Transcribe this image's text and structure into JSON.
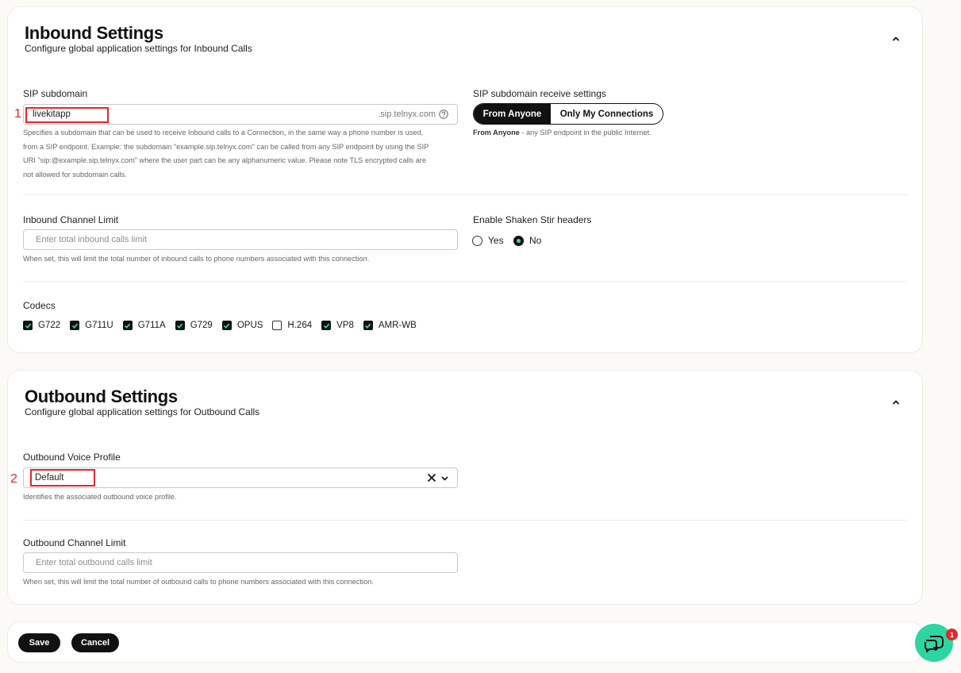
{
  "inbound": {
    "title": "Inbound Settings",
    "subtitle": "Configure global application settings for Inbound Calls",
    "sip_subdomain": {
      "label": "SIP subdomain",
      "value": "livekitapp",
      "suffix": ".sip.telnyx.com",
      "help": "Specifies a subdomain that can be used to receive Inbound calls to a Connection, in the same way a phone number is used, from a SIP endpoint. Example: the subdomain \"example.sip.telnyx.com\" can be called from any SIP endpoint by using the SIP URI \"sip:@example.sip.telnyx.com\" where the user part can be any alphanumeric value. Please note TLS encrypted calls are not allowed for subdomain calls.",
      "marker": "1"
    },
    "receive_settings": {
      "label": "SIP subdomain receive settings",
      "options": [
        "From Anyone",
        "Only My Connections"
      ],
      "selected": "From Anyone",
      "help_bold": "From Anyone",
      "help_rest": " - any SIP endpoint in the public Internet."
    },
    "channel_limit": {
      "label": "Inbound Channel Limit",
      "placeholder": "Enter total inbound calls limit",
      "help": "When set, this will limit the total number of inbound calls to phone numbers associated with this connection."
    },
    "shaken_stir": {
      "label": "Enable Shaken Stir headers",
      "options": [
        "Yes",
        "No"
      ],
      "selected": "No"
    },
    "codecs": {
      "label": "Codecs",
      "items": [
        {
          "name": "G722",
          "checked": true
        },
        {
          "name": "G711U",
          "checked": true
        },
        {
          "name": "G711A",
          "checked": true
        },
        {
          "name": "G729",
          "checked": true
        },
        {
          "name": "OPUS",
          "checked": true
        },
        {
          "name": "H.264",
          "checked": false
        },
        {
          "name": "VP8",
          "checked": true
        },
        {
          "name": "AMR-WB",
          "checked": true
        }
      ]
    }
  },
  "outbound": {
    "title": "Outbound Settings",
    "subtitle": "Configure global application settings for Outbound Calls",
    "voice_profile": {
      "label": "Outbound Voice Profile",
      "value": "Default",
      "help": "Identifies the associated outbound voice profile.",
      "marker": "2"
    },
    "channel_limit": {
      "label": "Outbound Channel Limit",
      "placeholder": "Enter total outbound calls limit",
      "help": "When set, this will limit the total number of outbound calls to phone numbers associated with this connection."
    }
  },
  "footer": {
    "save_label": "Save",
    "cancel_label": "Cancel"
  },
  "chat": {
    "badge_count": "1",
    "icon": "chat-support-icon"
  },
  "colors": {
    "accent": "#2dd6a0",
    "annotation": "#e3262b",
    "primary": "#111111"
  }
}
